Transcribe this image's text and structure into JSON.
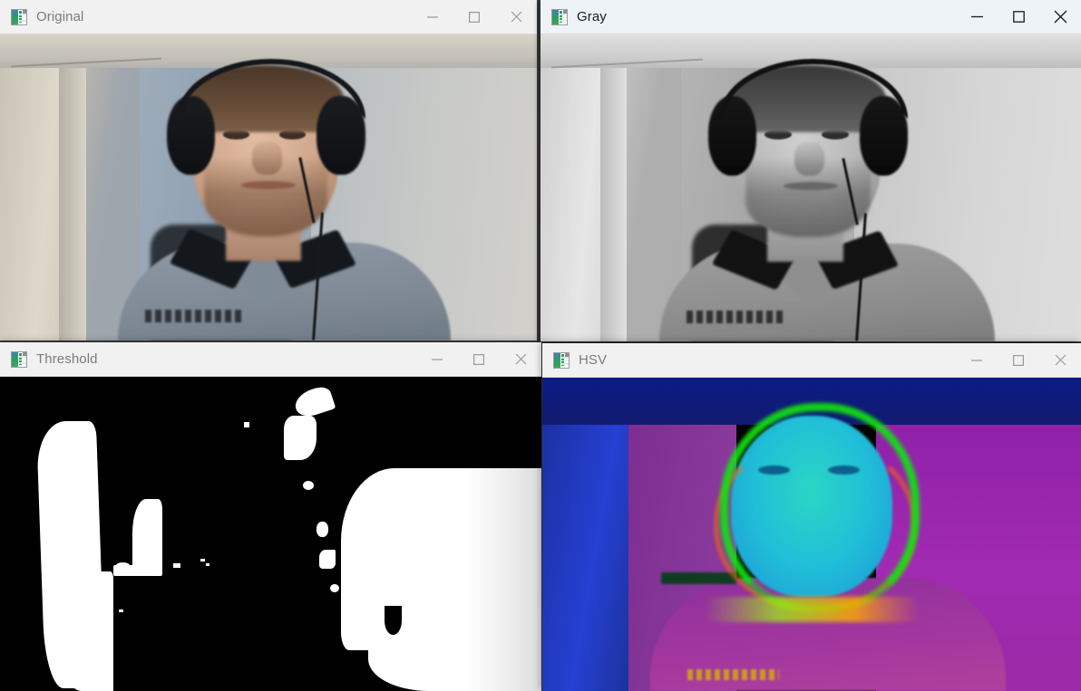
{
  "desktop": {
    "background_color": "#3a3a3a"
  },
  "windows": [
    {
      "id": "original",
      "title": "Original",
      "icon": "opencv-image-icon",
      "state": "inactive",
      "titlebar_color": "#f1f1f1",
      "title_color": "#7c7c7c",
      "controls": {
        "minimize": {
          "name": "minimize-button",
          "glyph": "—"
        },
        "maximize": {
          "name": "maximize-button",
          "glyph": "☐"
        },
        "close": {
          "name": "close-button",
          "glyph": "✕"
        }
      },
      "content_description": "Color webcam frame of a man wearing over-ear headphones with boom mic, seated in front of a beige and blue-gray wall"
    },
    {
      "id": "gray",
      "title": "Gray",
      "icon": "opencv-image-icon",
      "state": "active",
      "titlebar_color": "#eef3f7",
      "title_color": "#1b1b1b",
      "controls": {
        "minimize": {
          "name": "minimize-button",
          "glyph": "—"
        },
        "maximize": {
          "name": "maximize-button",
          "glyph": "☐"
        },
        "close": {
          "name": "close-button",
          "glyph": "✕"
        }
      },
      "content_description": "Grayscale conversion of the same webcam frame"
    },
    {
      "id": "threshold",
      "title": "Threshold",
      "icon": "opencv-image-icon",
      "state": "inactive",
      "titlebar_color": "#f1f1f1",
      "title_color": "#7c7c7c",
      "controls": {
        "minimize": {
          "name": "minimize-button",
          "glyph": "—"
        },
        "maximize": {
          "name": "maximize-button",
          "glyph": "☐"
        },
        "close": {
          "name": "close-button",
          "glyph": "✕"
        }
      },
      "content_description": "Binary black-and-white threshold mask of the same frame, white regions on the left wall edge and right side of the wall"
    },
    {
      "id": "hsv",
      "title": "HSV",
      "icon": "opencv-image-icon",
      "state": "inactive",
      "titlebar_color": "#eceef0",
      "title_color": "#7c7c7c",
      "controls": {
        "minimize": {
          "name": "minimize-button",
          "glyph": "—"
        },
        "maximize": {
          "name": "maximize-button",
          "glyph": "☐"
        },
        "close": {
          "name": "close-button",
          "glyph": "✕"
        }
      },
      "content_description": "HSV color-space rendering of the same frame: magenta shirt and wall, cyan face, green hair and edge rim, dark blue upper background"
    }
  ],
  "colors": {
    "window_chrome_inactive": "#f1f1f1",
    "window_chrome_active": "#eef3f7",
    "title_text_inactive": "#7c7c7c",
    "title_text_active": "#1b1b1b",
    "threshold_white": "#ffffff",
    "threshold_black": "#000000",
    "hsv_magenta": "#a12ab2",
    "hsv_blue": "#2540d2",
    "hsv_green": "#12e212",
    "hsv_cyan": "#21bfd8",
    "hsv_navy": "#0a1c86"
  }
}
